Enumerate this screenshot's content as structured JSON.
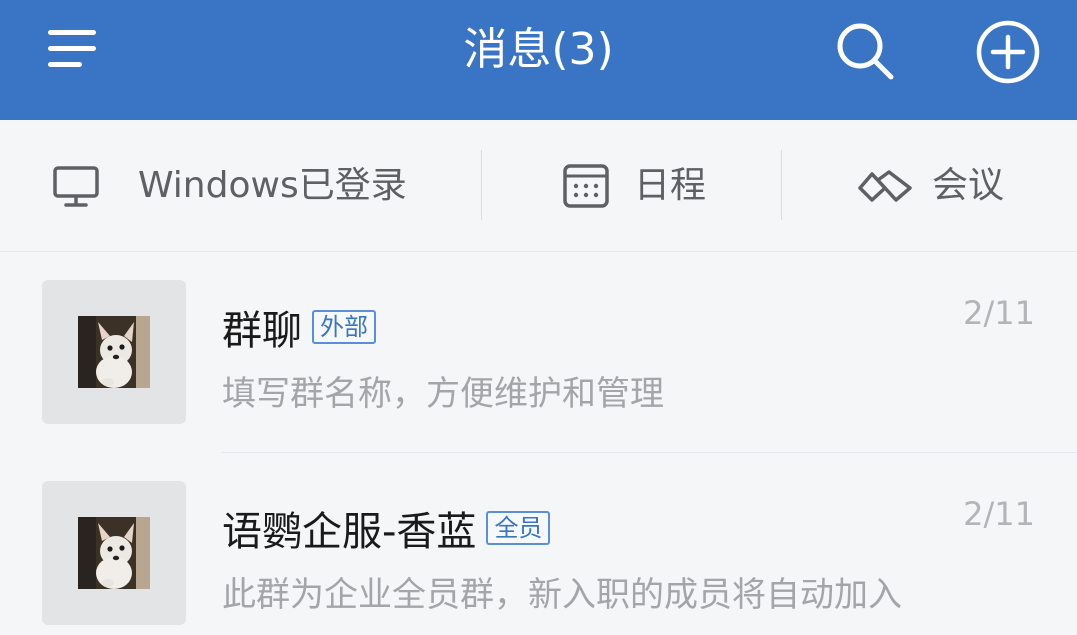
{
  "header": {
    "title": "消息(3)",
    "bg_color": "#3a74c4",
    "icons": [
      "hamburger-menu-icon",
      "search-icon",
      "add-circle-icon"
    ]
  },
  "quickbar": {
    "items": [
      {
        "label": "Windows已登录",
        "icon": "monitor-icon"
      },
      {
        "label": "日程",
        "icon": "calendar-icon"
      },
      {
        "label": "会议",
        "icon": "meeting-icon"
      }
    ]
  },
  "conversations": [
    {
      "name": "群聊",
      "badge": "外部",
      "time": "2/11",
      "preview": "填写群名称，方便维护和管理"
    },
    {
      "name": "语鹦企服-香蓝",
      "badge": "全员",
      "time": "2/11",
      "preview": "此群为企业全员群，新入职的成员将自动加入"
    }
  ],
  "colors": {
    "accent": "#3a74c4",
    "badge_border": "#5b8fd6",
    "muted_text": "#a4a5a8"
  }
}
